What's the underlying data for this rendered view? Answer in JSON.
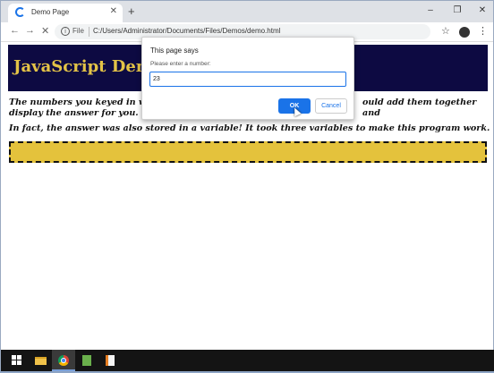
{
  "browser": {
    "tab_title": "Demo Page",
    "tab_close": "✕",
    "new_tab": "+",
    "minimize": "–",
    "restore": "❐",
    "close": "✕",
    "scheme": "File",
    "url": "C:/Users/Administrator/Documents/Files/Demos/demo.html",
    "back": "←",
    "forward": "→",
    "reload": "✕",
    "star": "☆",
    "menu": "⋮"
  },
  "page": {
    "banner_title": "JavaScript Demo",
    "para1_left": "The numbers you keyed in were",
    "para1_right": "ould add them together and",
    "para1_line2": "display the answer for you.",
    "para2": "In fact, the answer was also stored in a variable! It took three variables to make this program work."
  },
  "dialog": {
    "title": "This page says",
    "message": "Please enter a number:",
    "input_value": "23",
    "ok_label": "OK",
    "cancel_label": "Cancel"
  },
  "colors": {
    "banner_bg": "#0d0a42",
    "banner_text": "#e3c347",
    "answer_box": "#e4c23c",
    "accent": "#1a73e8"
  },
  "taskbar": {
    "icons": [
      "windows-start-icon",
      "file-explorer-icon",
      "chrome-icon",
      "document-icon",
      "file-icon"
    ]
  }
}
